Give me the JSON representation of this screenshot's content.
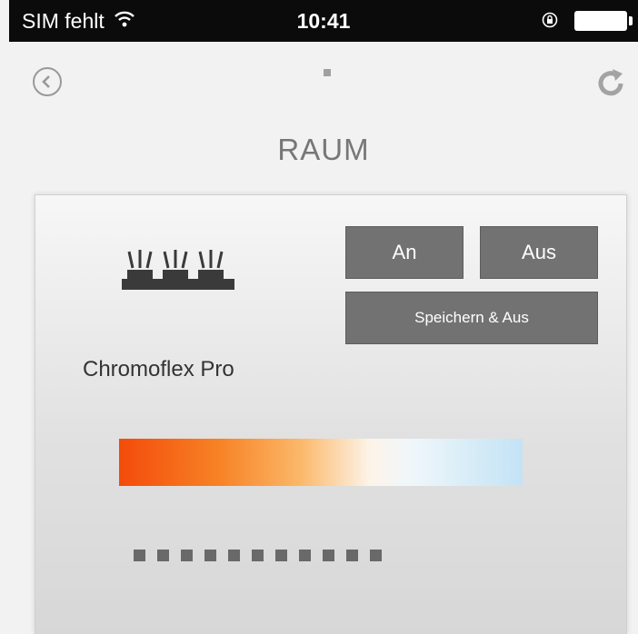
{
  "statusbar": {
    "carrier": "SIM fehlt",
    "time": "10:41",
    "icons": [
      "wifi-icon",
      "orientation-lock-icon",
      "battery-icon"
    ]
  },
  "navbar": {
    "back_icon": "back-circle-icon",
    "refresh_icon": "refresh-icon"
  },
  "page_title": "RAUM",
  "device": {
    "name": "Chromoflex Pro",
    "icon": "light-strip-icon",
    "buttons": {
      "on_label": "An",
      "off_label": "Aus",
      "save_off_label": "Speichern & Aus"
    },
    "color_range": [
      "#f44b0a",
      "#fbb86a",
      "#fdf3e8",
      "#c3e3f5"
    ],
    "square_count": 11
  },
  "colors": {
    "button_bg": "#727272",
    "status_bar_bg": "#0b0b0b"
  }
}
